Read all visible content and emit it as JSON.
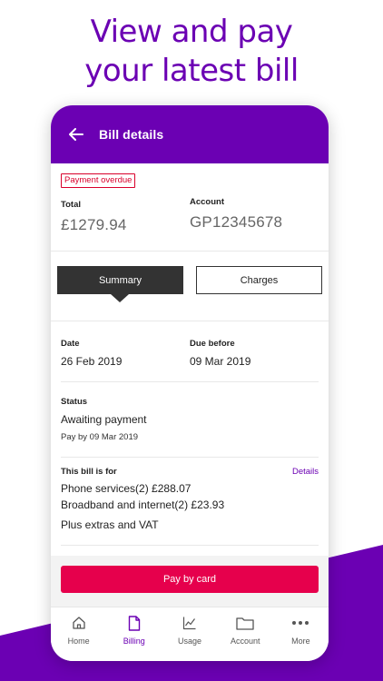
{
  "headline": {
    "line1": "View and pay",
    "line2": "your latest bill"
  },
  "colors": {
    "brand_purple": "#6b00b3",
    "pay_button": "#e6004c",
    "overdue_red": "#d9002b",
    "tab_active": "#333333"
  },
  "appbar": {
    "back_icon": "arrow-left-icon",
    "title": "Bill details"
  },
  "bill": {
    "status_badge": "Payment overdue",
    "total_label": "Total",
    "total_value": "£1279.94",
    "account_label": "Account",
    "account_value": "GP12345678"
  },
  "tabs": [
    {
      "label": "Summary",
      "selected": true
    },
    {
      "label": "Charges",
      "selected": false
    }
  ],
  "summary": {
    "date_label": "Date",
    "date_value": "26 Feb 2019",
    "due_label": "Due before",
    "due_value": "09 Mar 2019",
    "status_label": "Status",
    "status_value": "Awaiting payment",
    "status_sub": "Pay by 09 Mar 2019",
    "bill_for_label": "This bill is for",
    "details_link": "Details",
    "items": [
      "Phone services(2)  £288.07",
      "Broadband and internet(2)  £23.93",
      "Plus extras and VAT"
    ]
  },
  "pay_button": "Pay by card",
  "nav": [
    {
      "label": "Home",
      "icon": "home-icon",
      "active": false
    },
    {
      "label": "Billing",
      "icon": "document-icon",
      "active": true
    },
    {
      "label": "Usage",
      "icon": "chart-line-icon",
      "active": false
    },
    {
      "label": "Account",
      "icon": "folder-icon",
      "active": false
    },
    {
      "label": "More",
      "icon": "more-dots-icon",
      "active": false
    }
  ]
}
